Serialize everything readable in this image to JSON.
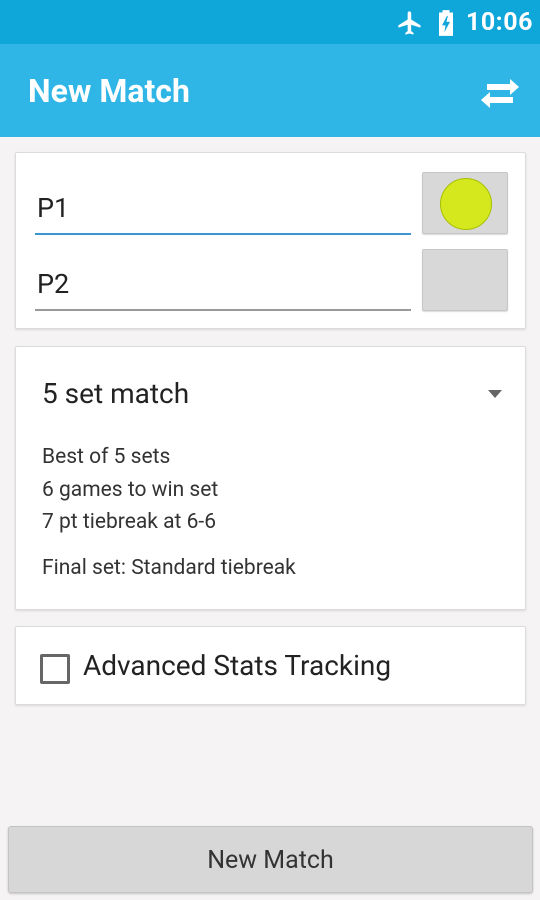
{
  "status_bar": {
    "time": "10:06",
    "icons": [
      "airplane-mode-icon",
      "battery-charging-icon"
    ]
  },
  "app_bar": {
    "title": "New Match",
    "action_icon": "swap-arrows-icon",
    "color": "#2fb6e7"
  },
  "players": {
    "p1": {
      "value": "P1",
      "color": "ball-yellow"
    },
    "p2": {
      "value": "P2",
      "color": "none"
    }
  },
  "match_format": {
    "selected": "5 set match",
    "details": [
      "Best of 5 sets",
      "6 games to win set",
      "7 pt tiebreak at 6-6"
    ],
    "final_set": "Final set: Standard tiebreak"
  },
  "advanced_stats": {
    "label": "Advanced Stats Tracking",
    "checked": false
  },
  "footer": {
    "button_label": "New Match"
  },
  "colors": {
    "status_bar": "#0fa6da",
    "accent": "#2fb6e7",
    "ball": "#d4e81d",
    "field_active_underline": "#3d96d2"
  }
}
